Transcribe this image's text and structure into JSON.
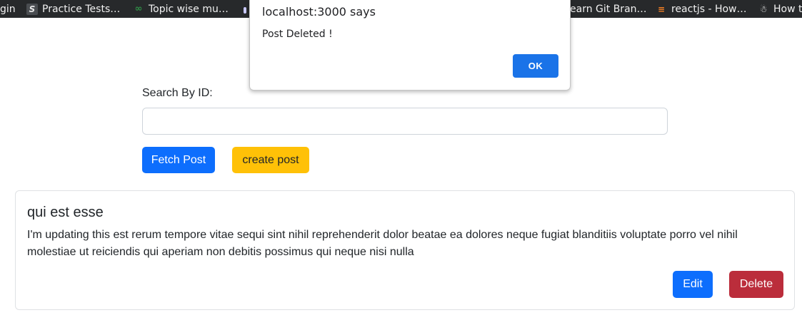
{
  "bookmarks": [
    {
      "label": "gin",
      "icon": "none"
    },
    {
      "label": "Practice Tests…",
      "icon": "s-logo-icon"
    },
    {
      "label": "Topic wise mu…",
      "icon": "geeksforgeeks-icon"
    },
    {
      "label": "",
      "icon": "pin-icon"
    },
    {
      "label": "earn Git Bran…",
      "icon": "none"
    },
    {
      "label": "reactjs - How…",
      "icon": "stackoverflow-icon"
    },
    {
      "label": "How t",
      "icon": "bot-icon"
    }
  ],
  "colors": {
    "primary": "#0d6efd",
    "warning": "#ffc107",
    "danger": "#bb2d3b",
    "dialog_ok": "#1a73e8"
  },
  "search": {
    "label": "Search By ID:",
    "value": "",
    "placeholder": ""
  },
  "actions": {
    "fetch_label": "Fetch Post",
    "create_label": "create post"
  },
  "post": {
    "title": "qui est esse",
    "body": "I'm updating this est rerum tempore vitae sequi sint nihil reprehenderit dolor beatae ea dolores neque fugiat blanditiis voluptate porro vel nihil molestiae ut reiciendis qui aperiam non debitis possimus qui neque nisi nulla",
    "edit_label": "Edit",
    "delete_label": "Delete"
  },
  "dialog": {
    "title": "localhost:3000 says",
    "message": "Post Deleted !",
    "ok_label": "OK"
  }
}
